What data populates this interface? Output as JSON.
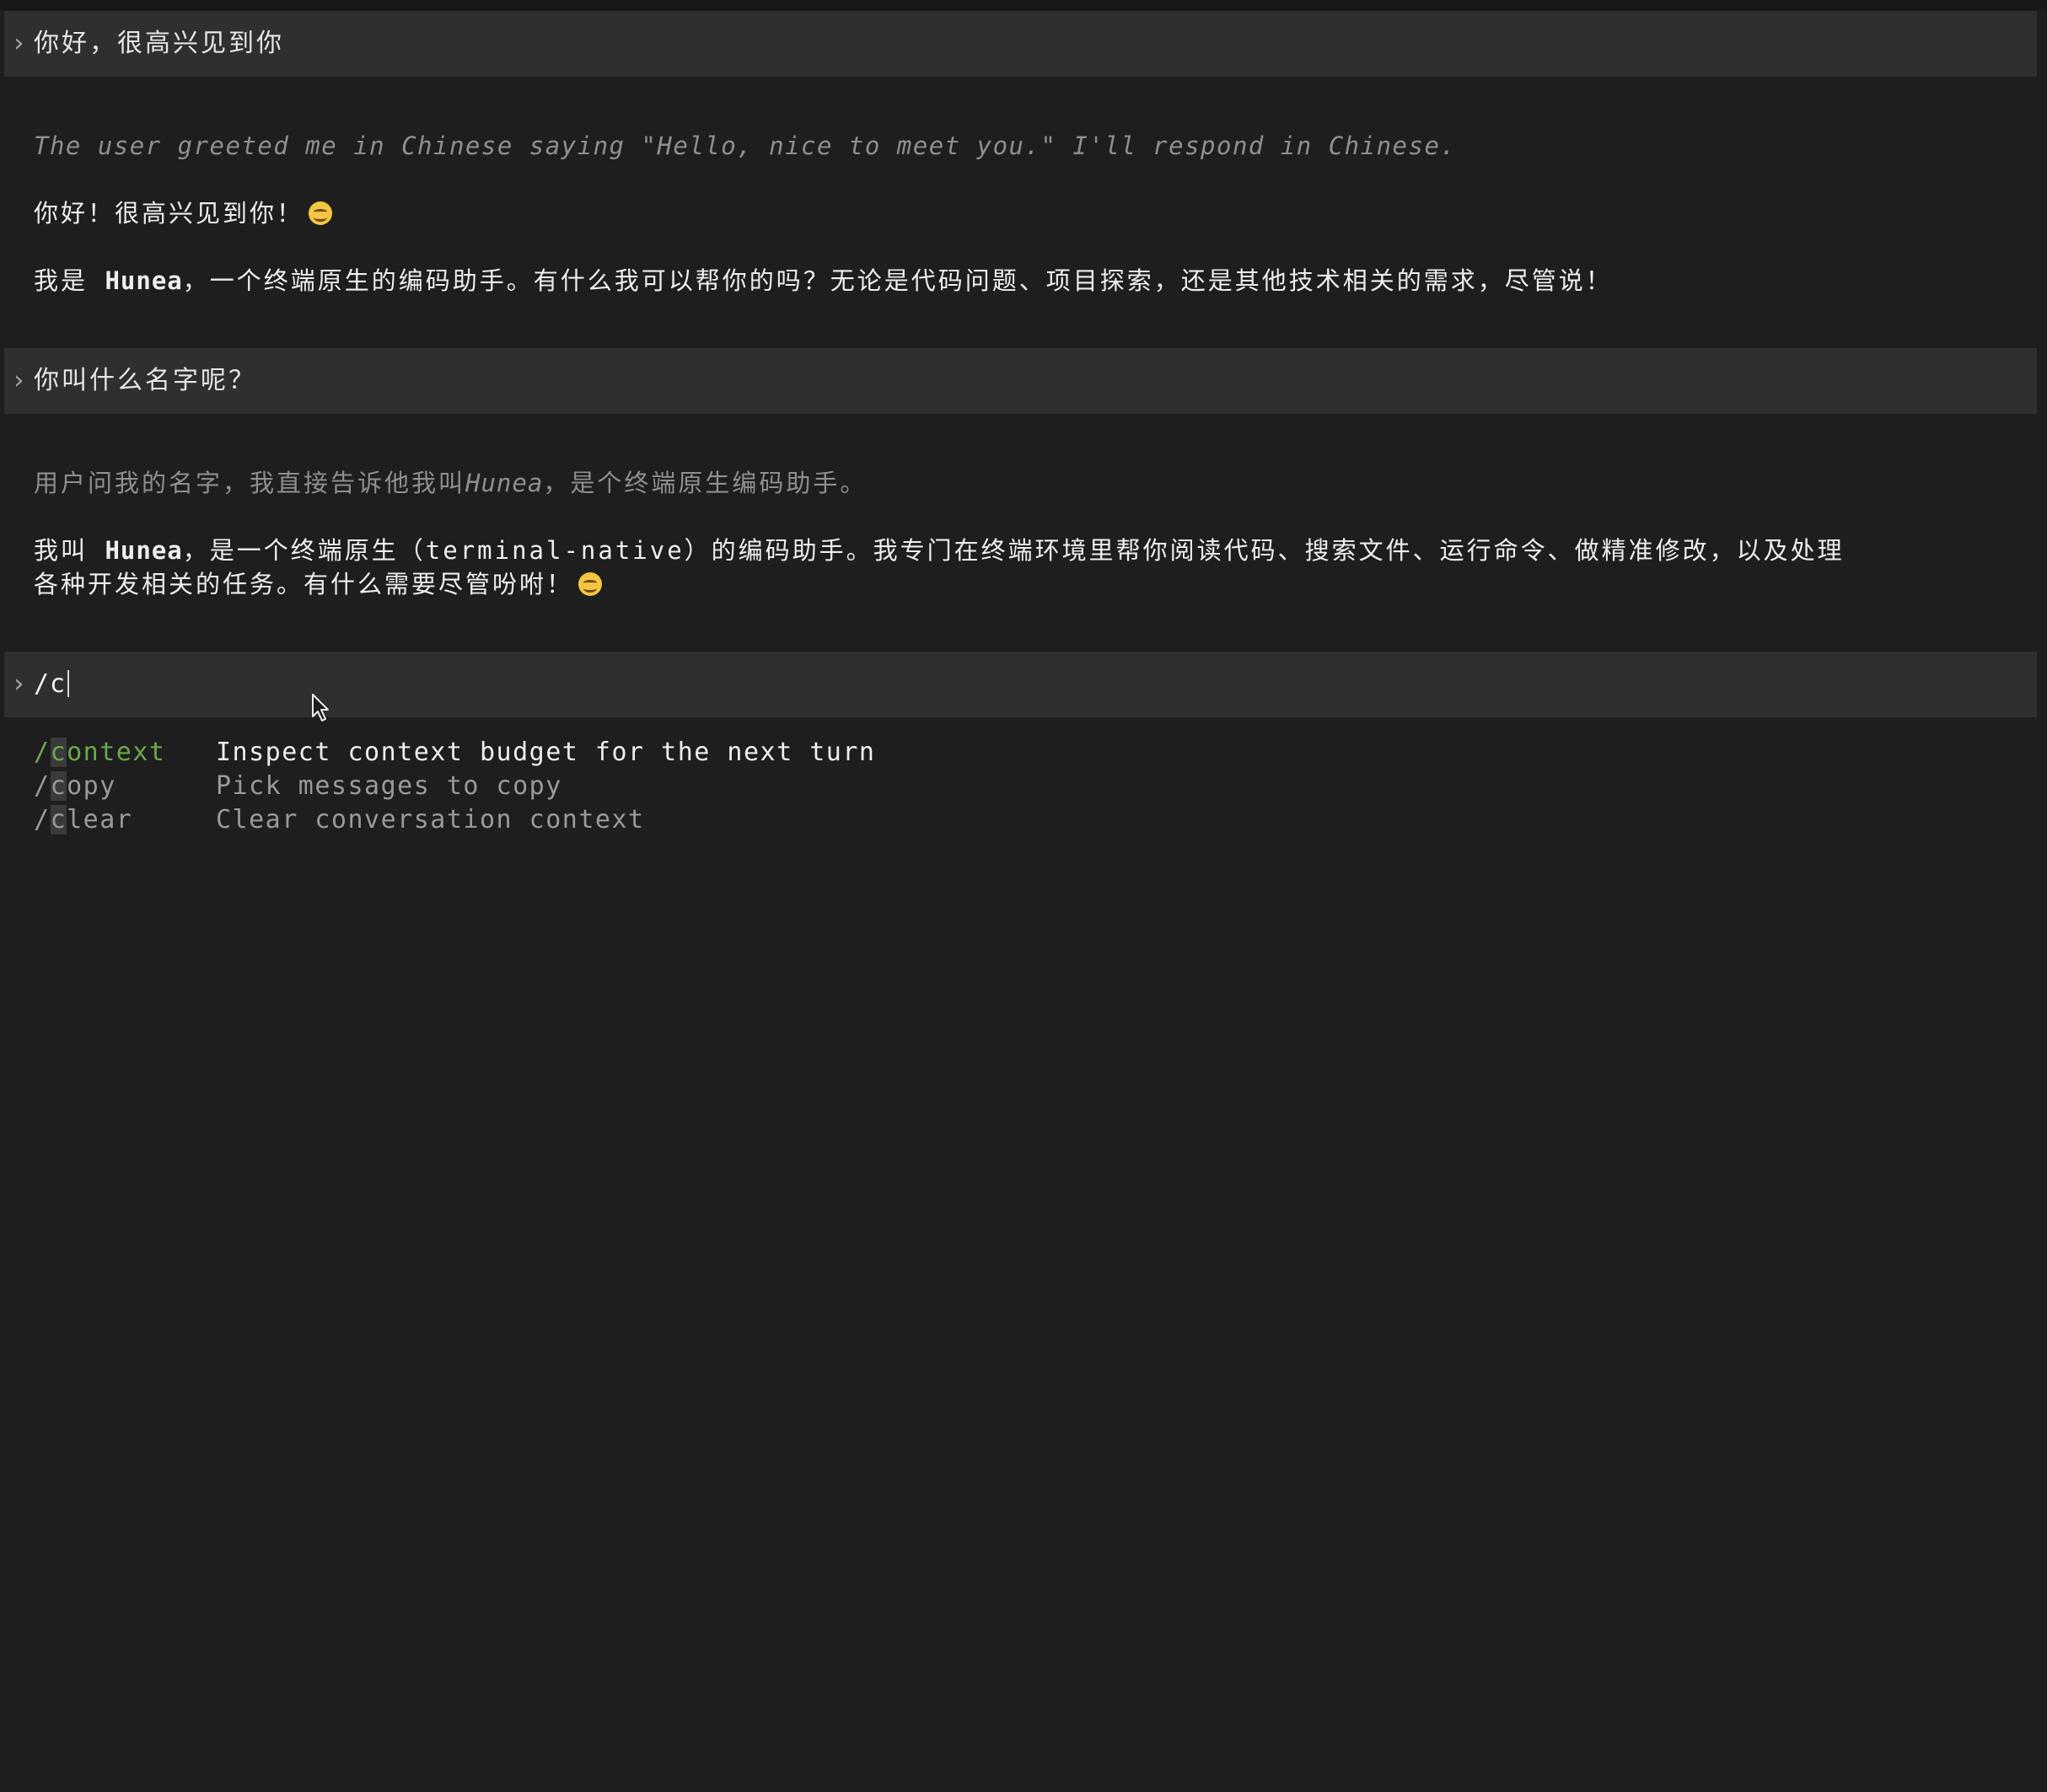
{
  "conversation": {
    "turn1": {
      "user_message": "你好，很高兴见到你",
      "thinking": "The user greeted me in Chinese saying \"Hello, nice to meet you.\" I'll respond in Chinese.",
      "reply_line1": "你好！很高兴见到你！",
      "reply_line2_prefix": "我是 ",
      "reply_line2_name": "Hunea",
      "reply_line2_suffix": "，一个终端原生的编码助手。有什么我可以帮你的吗？无论是代码问题、项目探索，还是其他技术相关的需求，尽管说！"
    },
    "turn2": {
      "user_message": "你叫什么名字呢？",
      "thinking_prefix": "用户问我的名字，我直接告诉他我叫",
      "thinking_name": "Hunea",
      "thinking_suffix": "，是个终端原生编码助手。",
      "reply_line1_prefix": "我叫 ",
      "reply_line1_name": "Hunea",
      "reply_line1_suffix": "，是一个终端原生（terminal-native）的编码助手。我专门在终端环境里帮你阅读代码、搜索文件、运行命令、做精准修改，以及处理",
      "reply_line2": "各种开发相关的任务。有什么需要尽管吩咐！"
    }
  },
  "input": {
    "prompt_symbol": "›",
    "value": "/c"
  },
  "suggestions": [
    {
      "slash": "/",
      "match": "c",
      "rest": "ontext",
      "description": "Inspect context budget for the next turn",
      "active": true
    },
    {
      "slash": "/",
      "match": "c",
      "rest": "opy",
      "description": "Pick messages to copy",
      "active": false
    },
    {
      "slash": "/",
      "match": "c",
      "rest": "lear",
      "description": "Clear conversation context",
      "active": false
    }
  ],
  "icons": {
    "prompt": "chevron-right-icon",
    "emoji": "smiling-face-icon",
    "cursor": "mouse-pointer-icon"
  },
  "colors": {
    "background": "#1e1e1e",
    "user_bar": "#2f2f2f",
    "text": "#eeeeee",
    "thinking": "#8f8f8f",
    "accent_green": "#6aa84f"
  }
}
